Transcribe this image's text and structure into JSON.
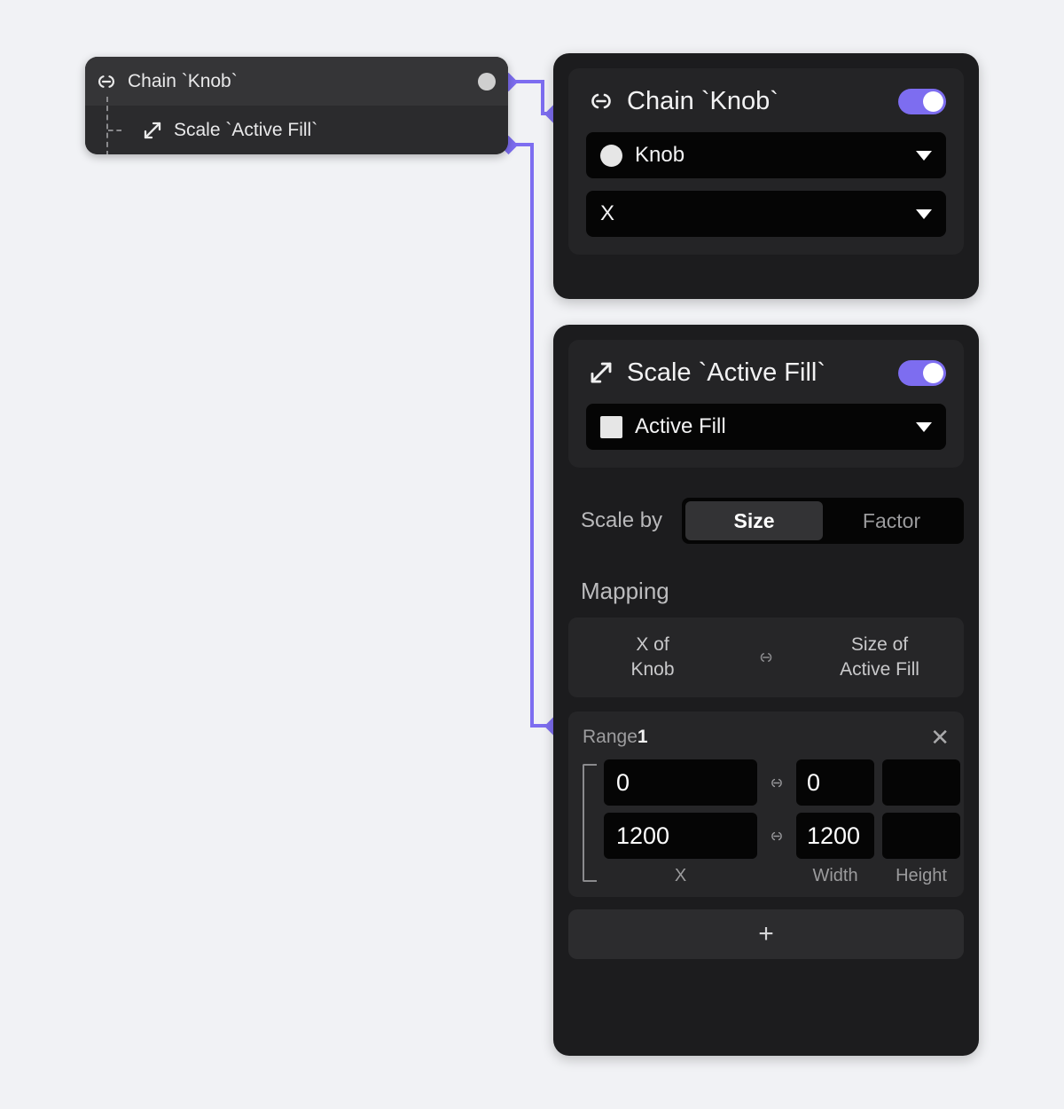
{
  "theme": {
    "canvas_bg": "#f1f2f5",
    "panel_bg": "#1c1c1e",
    "card_bg": "#242426",
    "input_bg": "#050505",
    "accent": "#7d6df0",
    "wire_color": "#7d6df0",
    "text_primary": "#f2f2f3",
    "text_muted": "#9b9b9d"
  },
  "tree": {
    "head": {
      "icon": "link-icon",
      "label": "Chain `Knob`",
      "port": "output-port-dot"
    },
    "child": {
      "icon": "scale-arrow-icon",
      "label": "Scale `Active Fill`"
    }
  },
  "chain_panel": {
    "header": {
      "icon": "link-icon",
      "title": "Chain `Knob`",
      "toggle_on": true
    },
    "target_select": {
      "icon": "circle-swatch-icon",
      "value": "Knob",
      "caret": "chevron-down-icon"
    },
    "property_select": {
      "value": "X",
      "caret": "chevron-down-icon"
    }
  },
  "scale_panel": {
    "header": {
      "icon": "scale-arrow-icon",
      "title": "Scale `Active Fill`",
      "toggle_on": true
    },
    "target_select": {
      "icon": "square-swatch-icon",
      "value": "Active Fill",
      "caret": "chevron-down-icon"
    },
    "scale_by": {
      "label": "Scale by",
      "options": [
        "Size",
        "Factor"
      ],
      "selected": "Size"
    },
    "mapping": {
      "title": "Mapping",
      "source_line1": "X of",
      "source_line2": "Knob",
      "link_icon": "link-icon",
      "target_line1": "Size of",
      "target_line2": "Active Fill"
    },
    "range": {
      "label": "Range",
      "index": "1",
      "close_icon": "close-icon",
      "link_icon": "link-icon",
      "rows": [
        {
          "source": "0",
          "width": "0",
          "height": ""
        },
        {
          "source": "1200",
          "width": "1200",
          "height": ""
        }
      ],
      "column_labels": [
        "X",
        "Width",
        "Height"
      ]
    },
    "add_button": {
      "label": "+",
      "icon": "plus-icon"
    }
  }
}
